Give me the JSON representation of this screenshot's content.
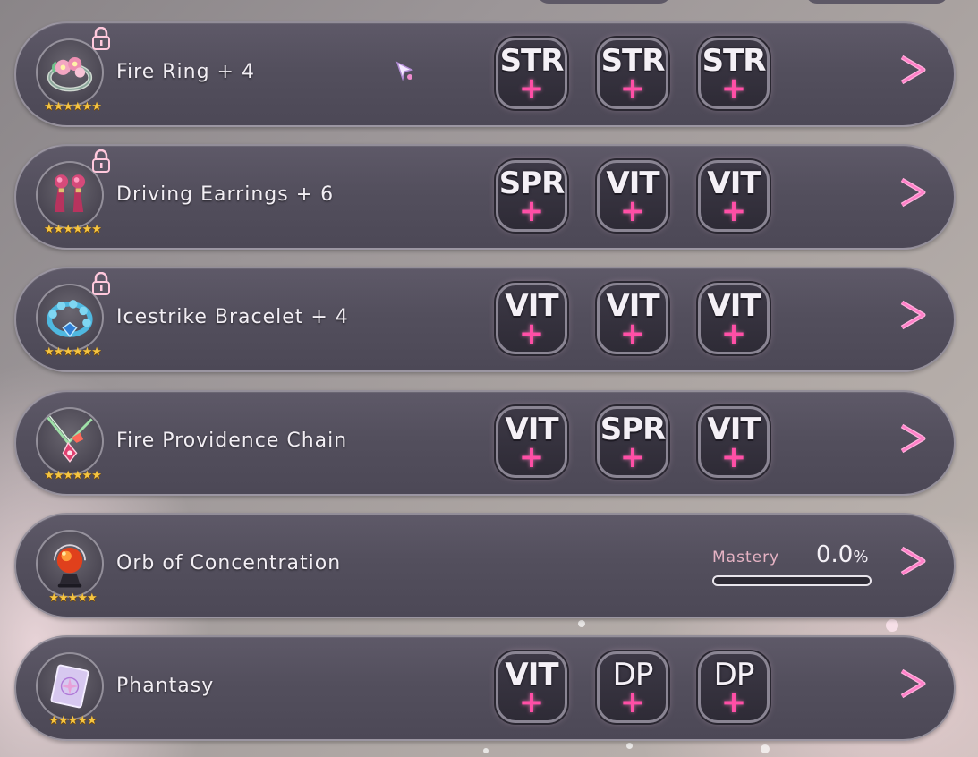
{
  "colors": {
    "panel": "#534f5d",
    "accent_plus": "#ff4fa6",
    "arrow": "#ff8fd0",
    "stars": "#f5c542",
    "mastery_label": "#e6b3c4"
  },
  "items": [
    {
      "name": "Fire Ring + 4",
      "icon": "ring-icon",
      "locked": true,
      "stars": "★★★★★★",
      "slots": [
        {
          "stat": "STR",
          "plus": "+"
        },
        {
          "stat": "STR",
          "plus": "+"
        },
        {
          "stat": "STR",
          "plus": "+"
        }
      ],
      "arrow": ">"
    },
    {
      "name": "Driving Earrings + 6",
      "icon": "earrings-icon",
      "locked": true,
      "stars": "★★★★★★",
      "slots": [
        {
          "stat": "SPR",
          "plus": "+"
        },
        {
          "stat": "VIT",
          "plus": "+"
        },
        {
          "stat": "VIT",
          "plus": "+"
        }
      ],
      "arrow": ">"
    },
    {
      "name": "Icestrike Bracelet + 4",
      "icon": "bracelet-icon",
      "locked": true,
      "stars": "★★★★★★",
      "slots": [
        {
          "stat": "VIT",
          "plus": "+"
        },
        {
          "stat": "VIT",
          "plus": "+"
        },
        {
          "stat": "VIT",
          "plus": "+"
        }
      ],
      "arrow": ">"
    },
    {
      "name": "Fire Providence Chain",
      "icon": "chain-icon",
      "locked": false,
      "stars": "★★★★★★",
      "slots": [
        {
          "stat": "VIT",
          "plus": "+"
        },
        {
          "stat": "SPR",
          "plus": "+"
        },
        {
          "stat": "VIT",
          "plus": "+"
        }
      ],
      "arrow": ">"
    },
    {
      "name": "Orb of Concentration",
      "icon": "orb-icon",
      "locked": false,
      "stars": "★★★★★",
      "mastery": {
        "label": "Mastery",
        "value": "0.0",
        "unit": "%",
        "progress": 0.0
      },
      "arrow": ">"
    },
    {
      "name": "Phantasy",
      "icon": "magic-card-icon",
      "locked": false,
      "stars": "★★★★★",
      "slots": [
        {
          "stat": "VIT",
          "plus": "+"
        },
        {
          "stat": "DP",
          "plus": "+"
        },
        {
          "stat": "DP",
          "plus": "+"
        }
      ],
      "arrow": ">"
    }
  ]
}
